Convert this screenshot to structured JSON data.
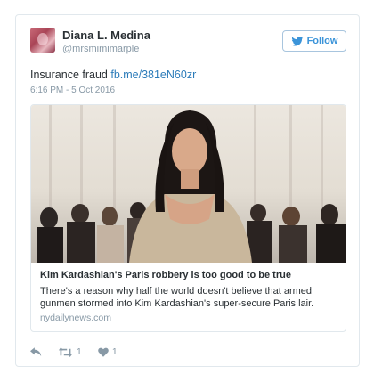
{
  "author": {
    "display_name": "Diana L. Medina",
    "handle": "@mrsmimimarple"
  },
  "follow_button": {
    "label": "Follow"
  },
  "tweet": {
    "text": "Insurance fraud",
    "link": "fb.me/381eN60zr",
    "timestamp": "6:16 PM - 5 Oct 2016"
  },
  "card": {
    "title": "Kim Kardashian's Paris robbery is too good to be true",
    "description": "There's a reason why half the world doesn't believe that armed gunmen stormed into Kim Kardashian's super-secure Paris lair.",
    "domain": "nydailynews.com"
  },
  "actions": {
    "retweet_count": "1",
    "like_count": "1"
  },
  "colors": {
    "link": "#2b7bb9",
    "follow_blue": "#3b94d9",
    "muted": "#8899a6",
    "border": "#e1e8ed"
  },
  "icons": [
    "twitter-bird-icon",
    "reply-icon",
    "retweet-icon",
    "heart-icon"
  ]
}
